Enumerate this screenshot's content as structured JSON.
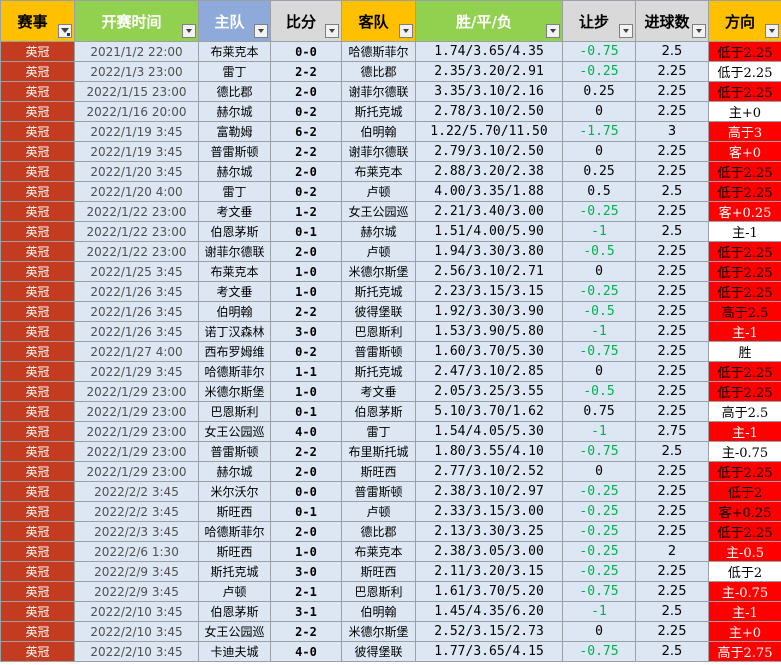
{
  "headers": {
    "league": "赛事",
    "time": "开赛时间",
    "home": "主队",
    "score": "比分",
    "away": "客队",
    "odds": "胜/平/负",
    "handicap": "让步",
    "goals": "进球数",
    "direction": "方向"
  },
  "colors": {
    "league_cell": "#c43c20",
    "row_bg": "#dde7f3",
    "direction_red": "#ff0000",
    "handicap_negative": "#00b050"
  },
  "rows": [
    {
      "league": "英冠",
      "time": "2021/1/2 22:00",
      "home": "布莱克本",
      "score": "0-0",
      "away": "哈德斯菲尔",
      "odds": "1.74/3.65/4.35",
      "handicap": "-0.75",
      "goals": "2.5",
      "direction": "低于2.25",
      "dir_style": "red"
    },
    {
      "league": "英冠",
      "time": "2022/1/3 23:00",
      "home": "雷丁",
      "score": "2-2",
      "away": "德比郡",
      "odds": "2.35/3.20/2.91",
      "handicap": "-0.25",
      "goals": "2.25",
      "direction": "低于2.25",
      "dir_style": "white"
    },
    {
      "league": "英冠",
      "time": "2022/1/15 23:00",
      "home": "德比郡",
      "score": "2-0",
      "away": "谢菲尔德联",
      "odds": "3.35/3.10/2.16",
      "handicap": "0.25",
      "goals": "2.25",
      "direction": "低于2.25",
      "dir_style": "red"
    },
    {
      "league": "英冠",
      "time": "2022/1/16 20:00",
      "home": "赫尔城",
      "score": "0-2",
      "away": "斯托克城",
      "odds": "2.78/3.10/2.50",
      "handicap": "0",
      "goals": "2.25",
      "direction": "主+0",
      "dir_style": "white"
    },
    {
      "league": "英冠",
      "time": "2022/1/19 3:45",
      "home": "富勒姆",
      "score": "6-2",
      "away": "伯明翰",
      "odds": "1.22/5.70/11.50",
      "handicap": "-1.75",
      "goals": "3",
      "direction": "高于3",
      "dir_style": "orange"
    },
    {
      "league": "英冠",
      "time": "2022/1/19 3:45",
      "home": "普雷斯顿",
      "score": "2-2",
      "away": "谢菲尔德联",
      "odds": "2.79/3.10/2.50",
      "handicap": "0",
      "goals": "2.25",
      "direction": "客+0",
      "dir_style": "orange"
    },
    {
      "league": "英冠",
      "time": "2022/1/20 3:45",
      "home": "赫尔城",
      "score": "2-0",
      "away": "布莱克本",
      "odds": "2.88/3.20/2.38",
      "handicap": "0.25",
      "goals": "2.25",
      "direction": "低于2.25",
      "dir_style": "red"
    },
    {
      "league": "英冠",
      "time": "2022/1/20 4:00",
      "home": "雷丁",
      "score": "0-2",
      "away": "卢顿",
      "odds": "4.00/3.35/1.88",
      "handicap": "0.5",
      "goals": "2.5",
      "direction": "低于2.25",
      "dir_style": "red"
    },
    {
      "league": "英冠",
      "time": "2022/1/22 23:00",
      "home": "考文垂",
      "score": "1-2",
      "away": "女王公园巡",
      "odds": "2.21/3.40/3.00",
      "handicap": "-0.25",
      "goals": "2.25",
      "direction": "客+0.25",
      "dir_style": "orange"
    },
    {
      "league": "英冠",
      "time": "2022/1/22 23:00",
      "home": "伯恩茅斯",
      "score": "0-1",
      "away": "赫尔城",
      "odds": "1.51/4.00/5.90",
      "handicap": "-1",
      "goals": "2.5",
      "direction": "主-1",
      "dir_style": "white"
    },
    {
      "league": "英冠",
      "time": "2022/1/22 23:00",
      "home": "谢菲尔德联",
      "score": "2-0",
      "away": "卢顿",
      "odds": "1.94/3.30/3.80",
      "handicap": "-0.5",
      "goals": "2.25",
      "direction": "低于2.25",
      "dir_style": "red"
    },
    {
      "league": "英冠",
      "time": "2022/1/25 3:45",
      "home": "布莱克本",
      "score": "1-0",
      "away": "米德尔斯堡",
      "odds": "2.56/3.10/2.71",
      "handicap": "0",
      "goals": "2.25",
      "direction": "低于2.25",
      "dir_style": "red"
    },
    {
      "league": "英冠",
      "time": "2022/1/26 3:45",
      "home": "考文垂",
      "score": "1-0",
      "away": "斯托克城",
      "odds": "2.23/3.15/3.15",
      "handicap": "-0.25",
      "goals": "2.25",
      "direction": "低于2.25",
      "dir_style": "red"
    },
    {
      "league": "英冠",
      "time": "2022/1/26 3:45",
      "home": "伯明翰",
      "score": "2-2",
      "away": "彼得堡联",
      "odds": "1.92/3.30/3.90",
      "handicap": "-0.5",
      "goals": "2.25",
      "direction": "高于2.5",
      "dir_style": "red"
    },
    {
      "league": "英冠",
      "time": "2022/1/26 3:45",
      "home": "诺丁汉森林",
      "score": "3-0",
      "away": "巴恩斯利",
      "odds": "1.53/3.90/5.80",
      "handicap": "-1",
      "goals": "2.25",
      "direction": "主-1",
      "dir_style": "orange"
    },
    {
      "league": "英冠",
      "time": "2022/1/27 4:00",
      "home": "西布罗姆维",
      "score": "0-2",
      "away": "普雷斯顿",
      "odds": "1.60/3.70/5.30",
      "handicap": "-0.75",
      "goals": "2.25",
      "direction": "胜",
      "dir_style": "white"
    },
    {
      "league": "英冠",
      "time": "2022/1/29 3:45",
      "home": "哈德斯菲尔",
      "score": "1-1",
      "away": "斯托克城",
      "odds": "2.47/3.10/2.85",
      "handicap": "0",
      "goals": "2.25",
      "direction": "低于2.25",
      "dir_style": "red"
    },
    {
      "league": "英冠",
      "time": "2022/1/29 23:00",
      "home": "米德尔斯堡",
      "score": "1-0",
      "away": "考文垂",
      "odds": "2.05/3.25/3.55",
      "handicap": "-0.5",
      "goals": "2.25",
      "direction": "低于2.25",
      "dir_style": "red"
    },
    {
      "league": "英冠",
      "time": "2022/1/29 23:00",
      "home": "巴恩斯利",
      "score": "0-1",
      "away": "伯恩茅斯",
      "odds": "5.10/3.70/1.62",
      "handicap": "0.75",
      "goals": "2.25",
      "direction": "高于2.5",
      "dir_style": "white"
    },
    {
      "league": "英冠",
      "time": "2022/1/29 23:00",
      "home": "女王公园巡",
      "score": "4-0",
      "away": "雷丁",
      "odds": "1.54/4.05/5.30",
      "handicap": "-1",
      "goals": "2.75",
      "direction": "主-1",
      "dir_style": "orange"
    },
    {
      "league": "英冠",
      "time": "2022/1/29 23:00",
      "home": "普雷斯顿",
      "score": "2-2",
      "away": "布里斯托城",
      "odds": "1.80/3.55/4.10",
      "handicap": "-0.75",
      "goals": "2.5",
      "direction": "主-0.75",
      "dir_style": "white"
    },
    {
      "league": "英冠",
      "time": "2022/1/29 23:00",
      "home": "赫尔城",
      "score": "2-0",
      "away": "斯旺西",
      "odds": "2.77/3.10/2.52",
      "handicap": "0",
      "goals": "2.25",
      "direction": "低于2.25",
      "dir_style": "red"
    },
    {
      "league": "英冠",
      "time": "2022/2/2 3:45",
      "home": "米尔沃尔",
      "score": "0-0",
      "away": "普雷斯顿",
      "odds": "2.38/3.10/2.97",
      "handicap": "-0.25",
      "goals": "2.25",
      "direction": "低于2",
      "dir_style": "red"
    },
    {
      "league": "英冠",
      "time": "2022/2/2 3:45",
      "home": "斯旺西",
      "score": "0-1",
      "away": "卢顿",
      "odds": "2.33/3.15/3.00",
      "handicap": "-0.25",
      "goals": "2.25",
      "direction": "客+0.25",
      "dir_style": "red"
    },
    {
      "league": "英冠",
      "time": "2022/2/3 3:45",
      "home": "哈德斯菲尔",
      "score": "2-0",
      "away": "德比郡",
      "odds": "2.13/3.30/3.25",
      "handicap": "-0.25",
      "goals": "2.25",
      "direction": "低于2.25",
      "dir_style": "red"
    },
    {
      "league": "英冠",
      "time": "2022/2/6 1:30",
      "home": "斯旺西",
      "score": "1-0",
      "away": "布莱克本",
      "odds": "2.38/3.05/3.00",
      "handicap": "-0.25",
      "goals": "2",
      "direction": "主-0.5",
      "dir_style": "orange"
    },
    {
      "league": "英冠",
      "time": "2022/2/9 3:45",
      "home": "斯托克城",
      "score": "3-0",
      "away": "斯旺西",
      "odds": "2.11/3.20/3.15",
      "handicap": "-0.25",
      "goals": "2.25",
      "direction": "低于2",
      "dir_style": "white"
    },
    {
      "league": "英冠",
      "time": "2022/2/9 3:45",
      "home": "卢顿",
      "score": "2-1",
      "away": "巴恩斯利",
      "odds": "1.61/3.70/5.20",
      "handicap": "-0.75",
      "goals": "2.25",
      "direction": "主-0.75",
      "dir_style": "orange"
    },
    {
      "league": "英冠",
      "time": "2022/2/10 3:45",
      "home": "伯恩茅斯",
      "score": "3-1",
      "away": "伯明翰",
      "odds": "1.45/4.35/6.20",
      "handicap": "-1",
      "goals": "2.5",
      "direction": "主-1",
      "dir_style": "orange"
    },
    {
      "league": "英冠",
      "time": "2022/2/10 3:45",
      "home": "女王公园巡",
      "score": "2-2",
      "away": "米德尔斯堡",
      "odds": "2.52/3.15/2.73",
      "handicap": "0",
      "goals": "2.25",
      "direction": "主+0",
      "dir_style": "orange"
    },
    {
      "league": "英冠",
      "time": "2022/2/10 3:45",
      "home": "卡迪夫城",
      "score": "4-0",
      "away": "彼得堡联",
      "odds": "1.77/3.65/4.15",
      "handicap": "-0.75",
      "goals": "2.5",
      "direction": "高于2.75",
      "dir_style": "orange"
    }
  ]
}
